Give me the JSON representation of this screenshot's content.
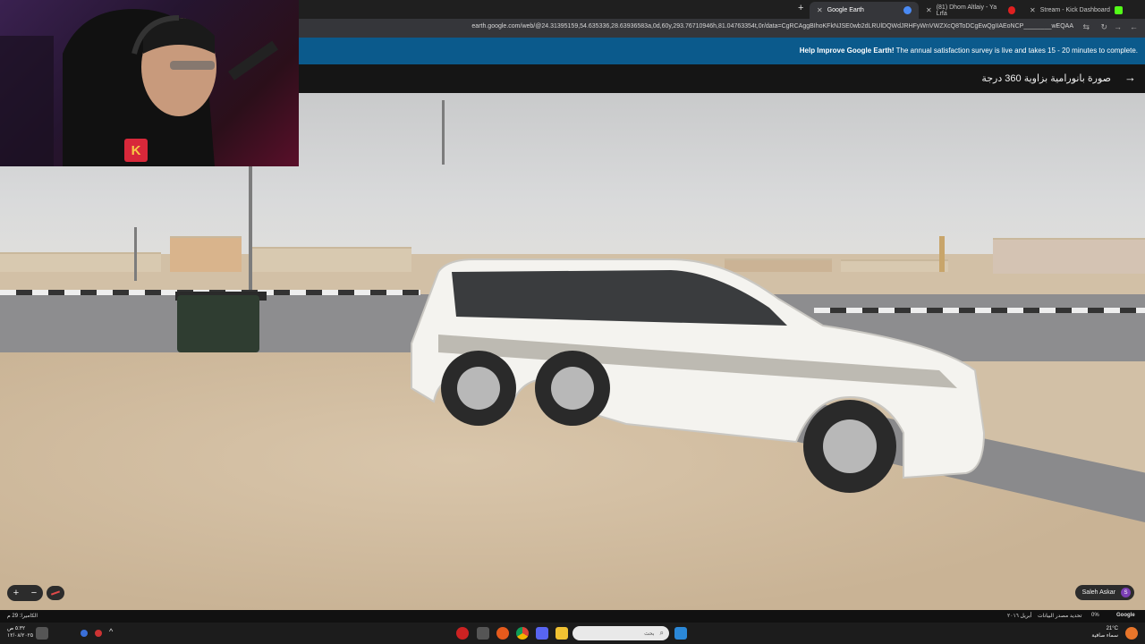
{
  "browser": {
    "tabs": [
      {
        "label": "Google Earth",
        "active": true,
        "favicon_color": "#4a8af4"
      },
      {
        "label": "(81) Dhom Altlaiy - Ya Lrfa",
        "active": false,
        "favicon_color": "#e02020"
      },
      {
        "label": "Stream - Kick Dashboard",
        "active": false,
        "favicon_color": "#53fc18"
      }
    ],
    "new_tab": "+",
    "url": "earth.google.com/web/@24.31395159,54.635336,28.63936583a,0d,60y,293.76710946h,81.04763354t,0r/data=CgRCAggBIhoKFkNJSE0wb2dLRUlDQWdJRHFyWnVWZXcQ8ToDCgEwQgIIAEoNCP________wEQAA"
  },
  "banner": {
    "bold": "Help Improve Google Earth!",
    "text": "The annual satisfaction survey is live and takes 15 - 20 minutes to complete."
  },
  "title": {
    "text": "صورة بانورامية بزاوية 360 درجة",
    "arrow": "→"
  },
  "controls": {
    "zoom_in": "+",
    "zoom_out": "−",
    "user_name": "Saleh Askar",
    "user_initial": "S"
  },
  "status_bar": {
    "camera": "الكاميرا: 29 م",
    "imagery_date": "أبريل ٢٠١٦",
    "data_sources": "تحديد مصدر البيانات",
    "percent": "0%",
    "google": "Google"
  },
  "taskbar": {
    "search_placeholder": "بحث",
    "weather_temp": "21°C",
    "weather_desc": "سماء صافية",
    "time": "٥:٣٢ ص",
    "date": "١٢/٠٨/٢٠٢٥"
  },
  "webcam": {
    "badge_letter": "K"
  },
  "colors": {
    "banner": "#0b5a8c",
    "title_bar": "#151515",
    "kick_badge": "#d8283a"
  }
}
